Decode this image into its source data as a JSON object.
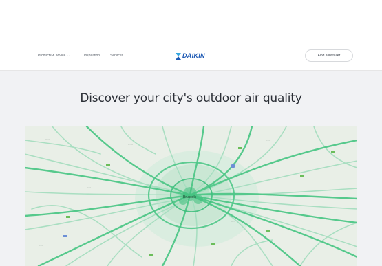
{
  "navbar": {
    "items": [
      {
        "label": "Products & advice",
        "has_dropdown": true
      },
      {
        "label": "Inspiration"
      },
      {
        "label": "Services"
      }
    ],
    "logo_text": "DAIKIN",
    "cta_label": "Find a installer"
  },
  "main": {
    "headline": "Discover your city's outdoor air quality"
  },
  "map": {
    "city_label": "Brussels",
    "colors": {
      "background": "#e9efe7",
      "road_green": "#52c98a",
      "road_light": "#9fdcb9",
      "urban": "#cfe7dc",
      "water": "#a9c6e8"
    }
  },
  "colors": {
    "brand_blue": "#1e5ab4",
    "brand_cyan": "#34a6e0",
    "page_bg": "#f1f2f4",
    "text_dark": "#2b2f36"
  }
}
